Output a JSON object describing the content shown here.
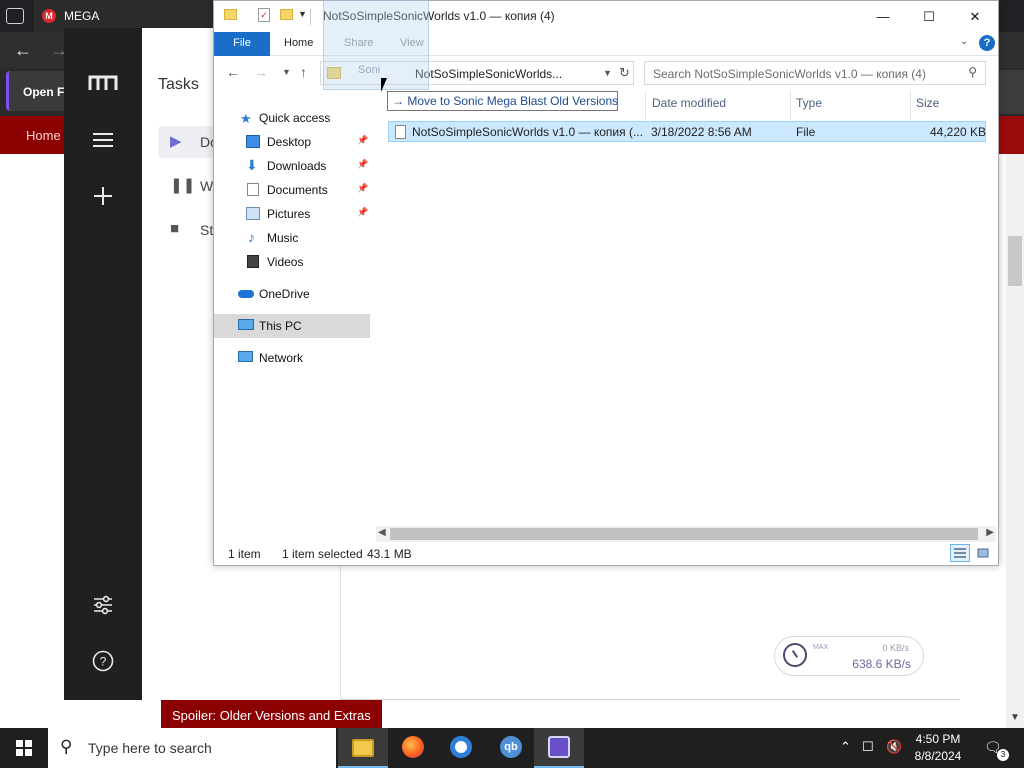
{
  "browser": {
    "tab_title": "MEGA",
    "mega_fav_letter": "M",
    "open_files_label": "Open Fi",
    "nav_home_label": "Home",
    "spoiler_label": "Spoiler: Older Versions and Extras"
  },
  "mega": {
    "tasks_title": "Tasks",
    "task_items": [
      {
        "label": "Do",
        "icon": "play-icon"
      },
      {
        "label": "W",
        "icon": "pause-icon"
      },
      {
        "label": "St",
        "icon": "stop-icon"
      }
    ],
    "speed": {
      "max_label": "MAX",
      "upload": "0 KB/s",
      "download": "638.6 KB/s"
    },
    "accent": "#d9272e"
  },
  "explorer": {
    "title": "NotSoSimpleSonicWorlds v1.0 — копия (4)",
    "window_buttons": {
      "minimize": "—",
      "maximize": "☐",
      "close": "✕"
    },
    "ribbon_tabs": {
      "file": "File",
      "home": "Home",
      "share": "Share",
      "view": "View"
    },
    "address_path": "NotSoSimpleSonicWorlds...",
    "search_placeholder": "Search NotSoSimpleSonicWorlds v1.0 — копия (4)",
    "drag_ghost_label": "Soni",
    "tooltip": "Move to Sonic Mega Blast Old Versions",
    "nav": {
      "quick_access": "Quick access",
      "desktop": "Desktop",
      "downloads": "Downloads",
      "documents": "Documents",
      "pictures": "Pictures",
      "music": "Music",
      "videos": "Videos",
      "onedrive": "OneDrive",
      "this_pc": "This PC",
      "network": "Network"
    },
    "columns": {
      "date": "Date modified",
      "type": "Type",
      "size": "Size"
    },
    "files": [
      {
        "name": "NotSoSimpleSonicWorlds v1.0 — копия (...",
        "date": "3/18/2022 8:56 AM",
        "type": "File",
        "size": "44,220 KB"
      }
    ],
    "status": {
      "count": "1 item",
      "selected": "1 item selected",
      "size": "43.1 MB"
    },
    "accent": "#1a6ec7"
  },
  "taskbar": {
    "search_placeholder": "Type here to search",
    "time": "4:50 PM",
    "date": "8/8/2024",
    "notification_count": "3"
  }
}
